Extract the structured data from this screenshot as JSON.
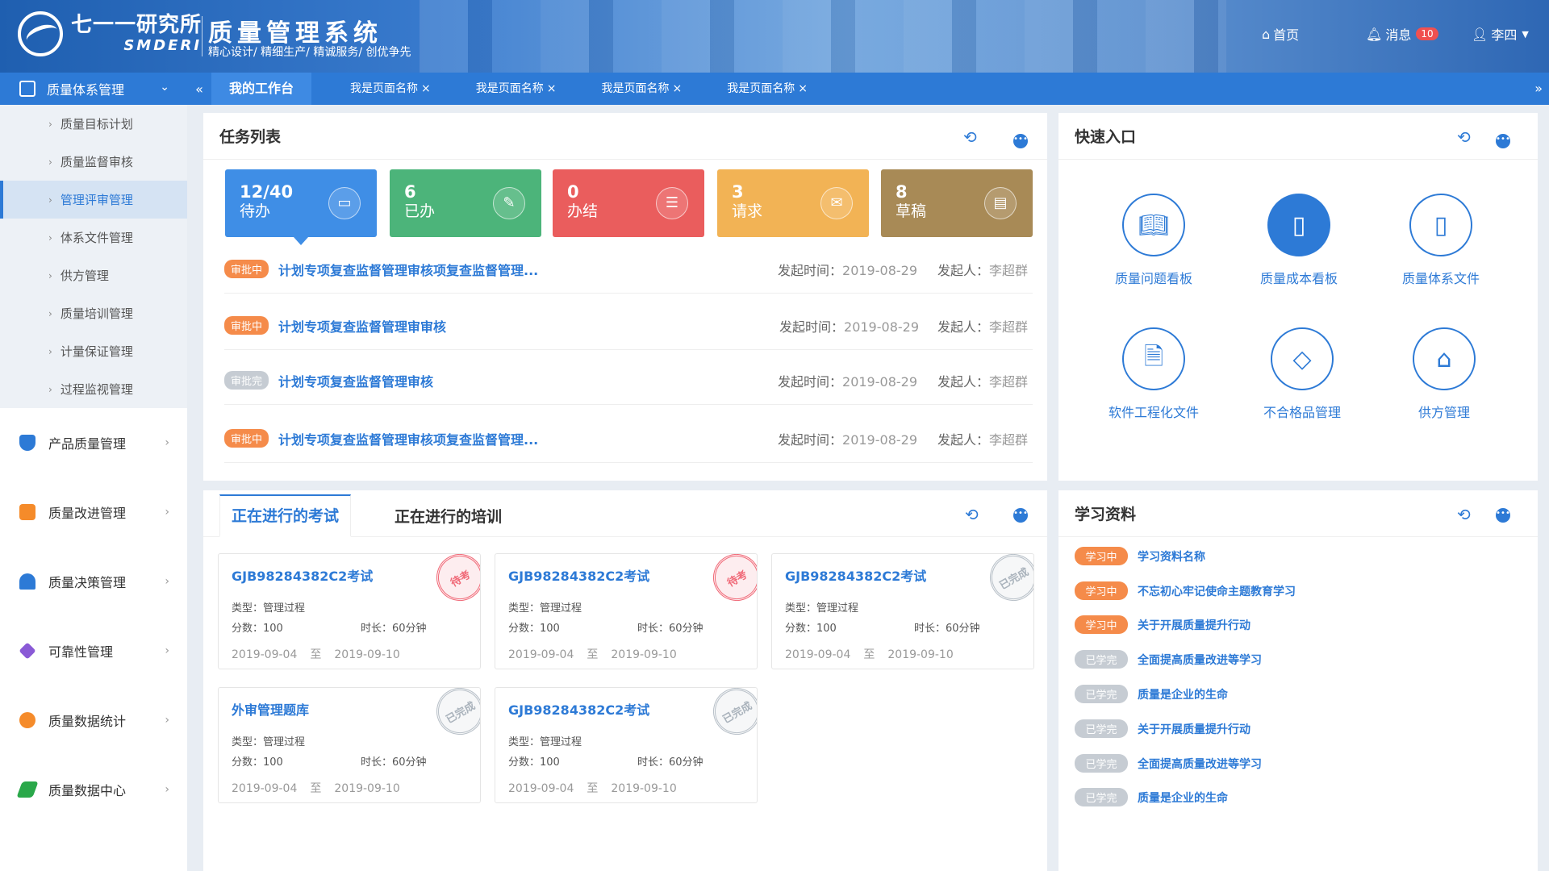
{
  "header": {
    "logo_cn": "七一一研究所",
    "logo_en": "SMDERI",
    "system_title": "质量管理系统",
    "slogan": "精心设计/ 精细生产/ 精诚服务/ 创优争先",
    "home_label": "首页",
    "messages_label": "消息",
    "messages_count": "10",
    "user_name": "李四"
  },
  "sidebar": {
    "group_label": "质量体系管理",
    "subitems": [
      "质量目标计划",
      "质量监督审核",
      "管理评审管理",
      "体系文件管理",
      "供方管理",
      "质量培训管理",
      "计量保证管理",
      "过程监视管理"
    ],
    "active_subitem": "管理评审管理",
    "items": [
      {
        "label": "产品质量管理",
        "color": "#2d7ad6"
      },
      {
        "label": "质量改进管理",
        "color": "#f58b2a"
      },
      {
        "label": "质量决策管理",
        "color": "#2d7ad6"
      },
      {
        "label": "可靠性管理",
        "color": "#8a5ad6"
      },
      {
        "label": "质量数据统计",
        "color": "#f58b2a"
      },
      {
        "label": "质量数据中心",
        "color": "#2aa84a"
      }
    ]
  },
  "tabs": {
    "active": "我的工作台",
    "items": [
      "我是页面名称",
      "我是页面名称",
      "我是页面名称",
      "我是页面名称"
    ],
    "close": "×"
  },
  "tasks": {
    "title": "任务列表",
    "stats": [
      {
        "num": "12/40",
        "label": "待办",
        "color": "#3f8ee6",
        "icon": "inbox-icon"
      },
      {
        "num": "6",
        "label": "已办",
        "color": "#4cb47a",
        "icon": "edit-icon"
      },
      {
        "num": "0",
        "label": "办结",
        "color": "#ea5d5d",
        "icon": "list-icon"
      },
      {
        "num": "3",
        "label": "请求",
        "color": "#f2b355",
        "icon": "request-icon"
      },
      {
        "num": "8",
        "label": "草稿",
        "color": "#a88a56",
        "icon": "draft-icon"
      }
    ],
    "time_label": "发起时间：",
    "initiator_label": "发起人：",
    "rows": [
      {
        "status": "审批中",
        "title": "计划专项复查监督管理审核项复查监督管理...",
        "time": "2019-08-29",
        "initiator": "李超群"
      },
      {
        "status": "审批中",
        "title": "计划专项复查监督管理审审核",
        "time": "2019-08-29",
        "initiator": "李超群"
      },
      {
        "status": "审批完",
        "title": "计划专项复查监督管理审核",
        "time": "2019-08-29",
        "initiator": "李超群"
      },
      {
        "status": "审批中",
        "title": "计划专项复查监督管理审核项复查监督管理...",
        "time": "2019-08-29",
        "initiator": "李超群"
      }
    ]
  },
  "quick": {
    "title": "快速入口",
    "items": [
      {
        "label": "质量问题看板",
        "icon": "book-icon"
      },
      {
        "label": "质量成本看板",
        "icon": "notebook-icon"
      },
      {
        "label": "质量体系文件",
        "icon": "document-icon"
      },
      {
        "label": "软件工程化文件",
        "icon": "file-icon"
      },
      {
        "label": "不合格品管理",
        "icon": "diamond-icon"
      },
      {
        "label": "供方管理",
        "icon": "shop-icon"
      }
    ]
  },
  "exams": {
    "tab_active": "正在进行的考试",
    "tab_other": "正在进行的培训",
    "type_label": "类型：",
    "score_label": "分数：",
    "duration_label": "时长：",
    "to_label": "至",
    "cards": [
      {
        "title": "GJB98284382C2考试",
        "type": "管理过程",
        "score": "100",
        "duration": "60分钟",
        "start": "2019-09-04",
        "end": "2019-09-10",
        "stamp": "待考"
      },
      {
        "title": "GJB98284382C2考试",
        "type": "管理过程",
        "score": "100",
        "duration": "60分钟",
        "start": "2019-09-04",
        "end": "2019-09-10",
        "stamp": "待考"
      },
      {
        "title": "GJB98284382C2考试",
        "type": "管理过程",
        "score": "100",
        "duration": "60分钟",
        "start": "2019-09-04",
        "end": "2019-09-10",
        "stamp": "已完成"
      },
      {
        "title": "外审管理题库",
        "type": "管理过程",
        "score": "100",
        "duration": "60分钟",
        "start": "2019-09-04",
        "end": "2019-09-10",
        "stamp": "已完成"
      },
      {
        "title": "GJB98284382C2考试",
        "type": "管理过程",
        "score": "100",
        "duration": "60分钟",
        "start": "2019-09-04",
        "end": "2019-09-10",
        "stamp": "已完成"
      }
    ]
  },
  "learning": {
    "title": "学习资料",
    "items": [
      {
        "status": "学习中",
        "title": "学习资料名称"
      },
      {
        "status": "学习中",
        "title": "不忘初心牢记使命主题教育学习"
      },
      {
        "status": "学习中",
        "title": "关于开展质量提升行动"
      },
      {
        "status": "已学完",
        "title": "全面提高质量改进等学习"
      },
      {
        "status": "已学完",
        "title": "质量是企业的生命"
      },
      {
        "status": "已学完",
        "title": "关于开展质量提升行动"
      },
      {
        "status": "已学完",
        "title": "全面提高质量改进等学习"
      },
      {
        "status": "已学完",
        "title": "质量是企业的生命"
      }
    ]
  }
}
